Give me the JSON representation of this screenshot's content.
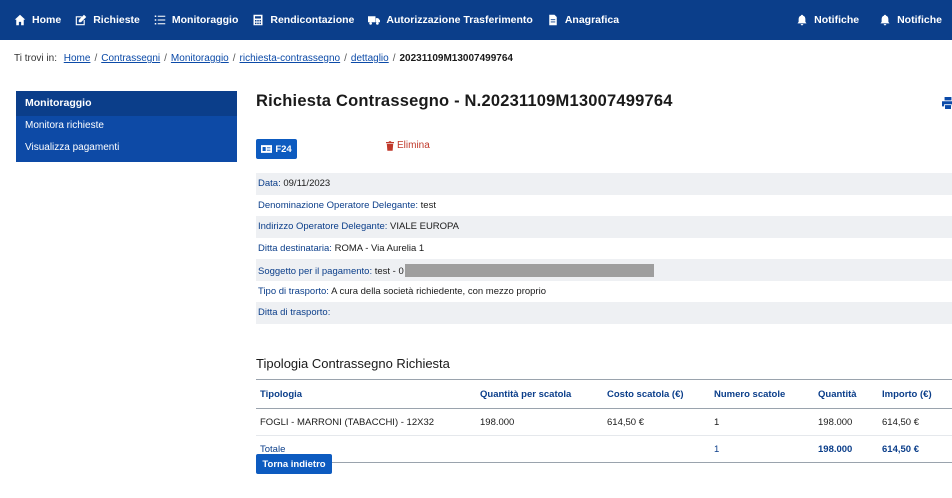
{
  "nav": {
    "items": [
      {
        "label": "Home",
        "icon": "home-icon"
      },
      {
        "label": "Richieste",
        "icon": "edit-icon"
      },
      {
        "label": "Monitoraggio",
        "icon": "list-icon"
      },
      {
        "label": "Rendicontazione",
        "icon": "calculator-icon"
      },
      {
        "label": "Autorizzazione Trasferimento",
        "icon": "truck-icon"
      },
      {
        "label": "Anagrafica",
        "icon": "file-icon"
      }
    ],
    "right_items": [
      {
        "label": "Notifiche",
        "icon": "bell-icon"
      },
      {
        "label": "Notifiche",
        "icon": "bell-icon"
      }
    ]
  },
  "breadcrumb": {
    "prefix": "Ti trovi in:",
    "links": [
      "Home",
      "Contrassegni",
      "Monitoraggio",
      "richiesta-contrassegno",
      "dettaglio"
    ],
    "current": "20231109M13007499764"
  },
  "sidebar": {
    "header": "Monitoraggio",
    "items": [
      "Monitora richieste",
      "Visualizza pagamenti"
    ]
  },
  "page": {
    "title": "Richiesta Contrassegno - N.20231109M13007499764",
    "btn_f24": "F24",
    "btn_elimina": "Elimina"
  },
  "details": [
    {
      "label": "Data:",
      "value": "09/11/2023"
    },
    {
      "label": "Denominazione Operatore Delegante:",
      "value": "test"
    },
    {
      "label": "Indirizzo Operatore Delegante:",
      "value": "VIALE EUROPA"
    },
    {
      "label": "Ditta destinataria:",
      "value": "ROMA - Via Aurelia 1"
    },
    {
      "label": "Soggetto per il pagamento:",
      "value": "test - 0"
    },
    {
      "label": "Tipo di trasporto:",
      "value": "A cura della società richiedente, con mezzo proprio"
    },
    {
      "label": "Ditta di trasporto:",
      "value": ""
    }
  ],
  "section_title": "Tipologia Contrassegno Richiesta",
  "table": {
    "headers": [
      "Tipologia",
      "Quantità per scatola",
      "Costo scatola (€)",
      "Numero scatole",
      "Quantità",
      "Importo (€)"
    ],
    "rows": [
      [
        "FOGLI - MARRONI (TABACCHI) - 12X32",
        "198.000",
        "614,50 €",
        "1",
        "198.000",
        "614,50 €"
      ]
    ],
    "total": [
      "Totale",
      "",
      "",
      "1",
      "198.000",
      "614,50 €"
    ]
  },
  "btn_back": "Torna indietro",
  "colors": {
    "nav_bg": "#0b3e8a",
    "sidebar_bg": "#0d4aa6",
    "button_bg": "#0d5bc0",
    "danger": "#c0392b"
  }
}
